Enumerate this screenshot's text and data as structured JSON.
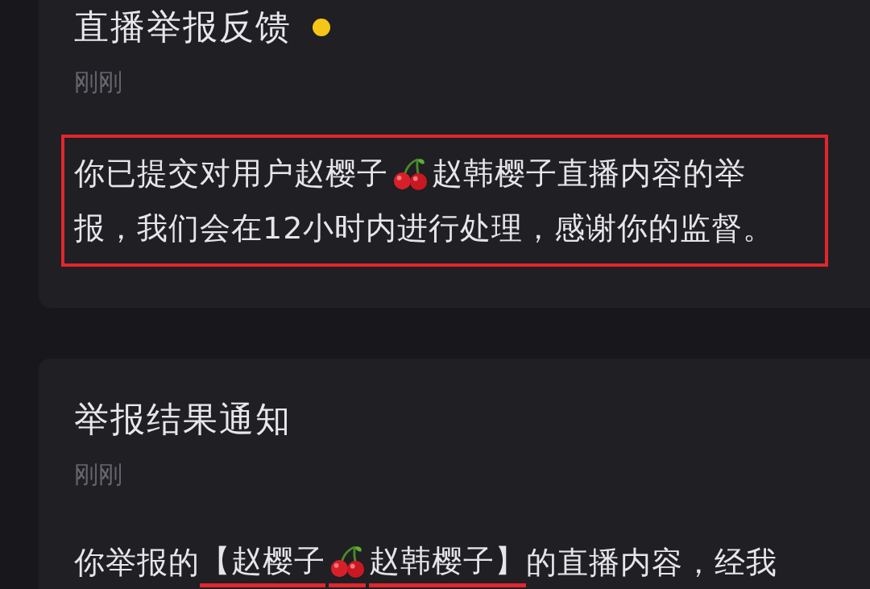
{
  "notifications": [
    {
      "title": "直播举报反馈",
      "unread": true,
      "time": "刚刚",
      "highlighted": true,
      "lines": [
        [
          {
            "kind": "text",
            "text": "你已提交对用户赵樱子",
            "underlined": false
          },
          {
            "kind": "cherry",
            "underlined": false
          },
          {
            "kind": "text",
            "text": "赵韩樱子直播内容的举",
            "underlined": false
          }
        ],
        [
          {
            "kind": "text",
            "text": "报，我们会在12小时内进行处理，感谢你的监督。",
            "underlined": false
          }
        ]
      ]
    },
    {
      "title": "举报结果通知",
      "unread": false,
      "time": "刚刚",
      "highlighted": false,
      "lines": [
        [
          {
            "kind": "text",
            "text": "你举报的",
            "underlined": false
          },
          {
            "kind": "text",
            "text": "【赵樱子",
            "underlined": true
          },
          {
            "kind": "cherry",
            "underlined": true
          },
          {
            "kind": "text",
            "text": "赵韩樱子】",
            "underlined": true
          },
          {
            "kind": "text",
            "text": "的直播内容，经我",
            "underlined": false
          }
        ]
      ]
    }
  ]
}
